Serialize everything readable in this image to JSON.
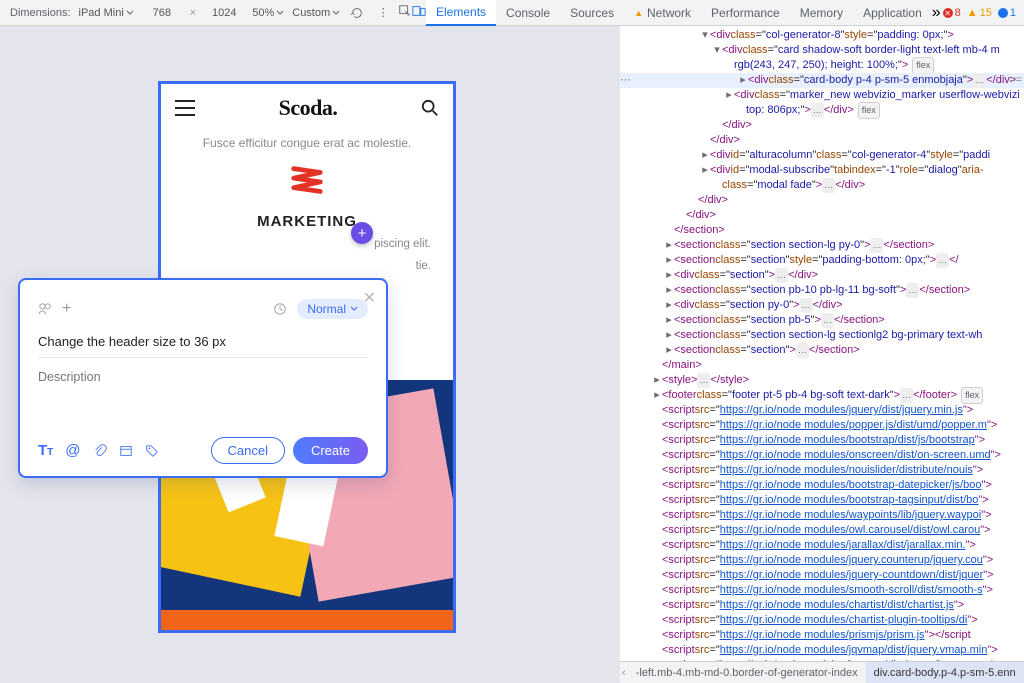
{
  "toolbar": {
    "dimensions_label": "Dimensions:",
    "device": "iPad Mini",
    "width": "768",
    "height": "1024",
    "zoom": "50%",
    "throttle": "Custom"
  },
  "panels": [
    "Elements",
    "Console",
    "Sources",
    "Network",
    "Performance",
    "Memory",
    "Application"
  ],
  "panels_active": 0,
  "panels_warn": 3,
  "status": {
    "errors": "8",
    "warnings": "15",
    "info": "1"
  },
  "device_preview": {
    "logo": "Scoda.",
    "subline": "Fusce efficitur congue erat ac molestie.",
    "heading": "MARKETING",
    "lorem1": "piscing elit.",
    "lorem2": "tie."
  },
  "annotation": {
    "priority_label": "Normal",
    "title": "Change the header size to 36 px",
    "description_placeholder": "Description",
    "cancel": "Cancel",
    "create": "Create"
  },
  "dom": [
    {
      "d": 6,
      "c": "open",
      "html": "<t>&lt;div</t> <a>class</a>=\"<v>col-generator-8</v>\" <a>style</a>=\"<v>padding: 0px;</v>\"<t>&gt;</t>"
    },
    {
      "d": 7,
      "c": "open",
      "html": "<t>&lt;div</t> <a>class</a>=\"<v>card shadow-soft border-light text-left mb-4 m</v>",
      "tail": ""
    },
    {
      "d": 8,
      "c": "none",
      "html": "<v>rgb(243, 247, 250); height: 100%;</v>\"<t>&gt;</t>",
      "flex": true
    },
    {
      "d": 8,
      "c": "closed",
      "hl": true,
      "dots": true,
      "html": "<t>&lt;div</t> <a>class</a>=\"<v>card-body p-4 p-sm-5 enmobjaja</v>\"<t>&gt;</t><e>…</e> <t>&lt;/div&gt;</t>"
    },
    {
      "d": 8,
      "c": "closed",
      "html": "<t>&lt;div</t> <a>class</a>=\"<v>marker_new webvizio_marker userflow-webvizi</v>"
    },
    {
      "d": 9,
      "c": "none",
      "html": "<v>top: 806px;</v>\"<t>&gt;</t><e>…</e> <t>&lt;/div&gt;</t>",
      "flex": true
    },
    {
      "d": 7,
      "c": "none",
      "html": "<t>&lt;/div&gt;</t>"
    },
    {
      "d": 6,
      "c": "none",
      "html": "<t>&lt;/div&gt;</t>"
    },
    {
      "d": 6,
      "c": "closed",
      "html": "<t>&lt;div</t> <a>id</a>=\"<v>alturacolumn</v>\" <a>class</a>=\"<v>col-generator-4</v>\" <a>style</a>=\"<v>paddi</v>"
    },
    {
      "d": 6,
      "c": "closed",
      "html": "<t>&lt;div</t> <a>id</a>=\"<v>modal-subscribe</v>\" <a>tabindex</a>=\"<v>-1</v>\" <a>role</a>=\"<v>dialog</v>\" <a>aria-</a>"
    },
    {
      "d": 7,
      "c": "none",
      "html": "<a>class</a>=\"<v>modal fade</v>\"<t>&gt;</t><e>…</e> <t>&lt;/div&gt;</t>"
    },
    {
      "d": 5,
      "c": "none",
      "html": "<t>&lt;/div&gt;</t>"
    },
    {
      "d": 4,
      "c": "none",
      "html": "<t>&lt;/div&gt;</t>"
    },
    {
      "d": 3,
      "c": "none",
      "html": "<t>&lt;/section&gt;</t>"
    },
    {
      "d": 3,
      "c": "closed",
      "html": "<t>&lt;section</t> <a>class</a>=\"<v>section section-lg py-0</v>\"<t>&gt;</t><e>…</e> <t>&lt;/section&gt;</t>"
    },
    {
      "d": 3,
      "c": "closed",
      "html": "<t>&lt;section</t> <a>class</a>=\"<v>section</v>\" <a>style</a>=\"<v>padding-bottom: 0px;</v>\"<t>&gt;</t><e>…</e> <t>&lt;/</t>"
    },
    {
      "d": 3,
      "c": "closed",
      "html": "<t>&lt;div</t> <a>class</a>=\"<v>section</v>\"<t>&gt;</t><e>…</e> <t>&lt;/div&gt;</t>"
    },
    {
      "d": 3,
      "c": "closed",
      "html": "<t>&lt;section</t> <a>class</a>=\"<v>section pb-10 pb-lg-11 bg-soft</v>\"<t>&gt;</t><e>…</e> <t>&lt;/section&gt;</t>"
    },
    {
      "d": 3,
      "c": "closed",
      "html": "<t>&lt;div</t> <a>class</a>=\"<v>section py-0</v>\"<t>&gt;</t><e>…</e> <t>&lt;/div&gt;</t>"
    },
    {
      "d": 3,
      "c": "closed",
      "html": "<t>&lt;section</t> <a>class</a>=\"<v>section pb-5</v>\"<t>&gt;</t><e>…</e> <t>&lt;/section&gt;</t>"
    },
    {
      "d": 3,
      "c": "closed",
      "html": "<t>&lt;section</t> <a>class</a>=\"<v>section section-lg sectionlg2 bg-primary text-wh</v>"
    },
    {
      "d": 3,
      "c": "closed",
      "html": "<t>&lt;section</t> <a>class</a>=\"<v>section</v>\"<t>&gt;</t><e>…</e> <t>&lt;/section&gt;</t>"
    },
    {
      "d": 2,
      "c": "none",
      "html": "<t>&lt;/main&gt;</t>"
    },
    {
      "d": 2,
      "c": "closed",
      "html": "<t>&lt;style&gt;</t><e>…</e> <t>&lt;/style&gt;</t>"
    },
    {
      "d": 2,
      "c": "closed",
      "html": "<t>&lt;footer</t> <a>class</a>=\"<v>footer pt-5 pb-4 bg-soft text-dark</v>\"<t>&gt;</t><e>…</e> <t>&lt;/footer&gt;</t>",
      "flex": true
    }
  ],
  "scripts": [
    "https://gr.io/node modules/jquery/dist/jquery.min.js",
    "https://gr.io/node modules/popper.js/dist/umd/popper.m",
    "https://gr.io/node modules/bootstrap/dist/js/bootstrap",
    "https://gr.io/node modules/onscreen/dist/on-screen.umd",
    "https://gr.io/node modules/nouislider/distribute/nouis",
    "https://gr.io/node modules/bootstrap-datepicker/js/boo",
    "https://gr.io/node modules/bootstrap-tagsinput/dist/bo",
    "https://gr.io/node modules/waypoints/lib/jquery.waypoi",
    "https://gr.io/node modules/owl.carousel/dist/owl.carou",
    "https://gr.io/node modules/jarallax/dist/jarallax.min.",
    "https://gr.io/node modules/jquery.counterup/jquery.cou",
    "https://gr.io/node modules/jquery-countdown/dist/jquer",
    "https://gr.io/node modules/smooth-scroll/dist/smooth-s",
    "https://gr.io/node modules/chartist/dist/chartist.js",
    "https://gr.io/node modules/chartist-plugin-tooltips/di",
    "https://gr.io/node modules/prismjs/prism.js",
    "https://gr.io/node modules/jqvmap/dist/jquery.vmap.min",
    "https://gr.io/node modules/jqvmap/dist/maps/jquery.vma"
  ],
  "script_depth": 2,
  "crumbs": [
    "-left.mb-4.mb-md-0.border-of-generator-index",
    "div.card-body.p-4.p-sm-5.enn"
  ],
  "flex_badge": "flex"
}
